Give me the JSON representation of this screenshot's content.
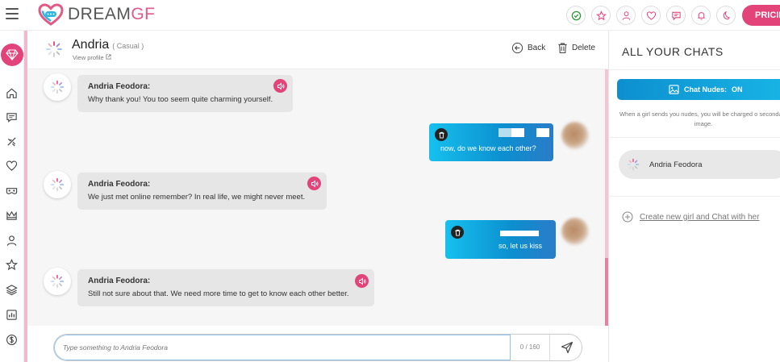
{
  "app": {
    "logo_brand": "DREAM",
    "logo_suffix": "GF",
    "pricing_label": "PRICING",
    "brand_color": "#e2447a"
  },
  "top_icons": [
    "badge-check-icon",
    "star-icon",
    "user-icon",
    "heart-icon",
    "chat-icon",
    "bell-icon",
    "moon-icon"
  ],
  "sidebar": {
    "items": [
      "home-icon",
      "chat-icon",
      "sliders-icon",
      "heart-icon",
      "mask-icon",
      "crown-icon",
      "user-icon",
      "star-icon",
      "layers-icon",
      "gallery-icon",
      "dollar-icon"
    ]
  },
  "chat_header": {
    "name": "Andria",
    "mood": "( Casual )",
    "view_profile": "View profile",
    "back_label": "Back",
    "delete_label": "Delete"
  },
  "messages": [
    {
      "from": "bot",
      "sender": "Andria Feodora:",
      "text": "Why thank you! You too seem quite charming yourself."
    },
    {
      "from": "user",
      "text": "now, do we know each other?"
    },
    {
      "from": "bot",
      "sender": "Andria Feodora:",
      "text": "We just met online remember? In real life, we might never meet."
    },
    {
      "from": "user",
      "text": "so, let us kiss"
    },
    {
      "from": "bot",
      "sender": "Andria Feodora:",
      "text": "Still not sure about that. We need more time to get to know each other better."
    }
  ],
  "input": {
    "placeholder": "Type something to Andria Feodora",
    "char_count": "0 / 160"
  },
  "right_panel": {
    "title": "ALL YOUR CHATS",
    "nudes_label": "Chat Nudes:",
    "nudes_state": "ON",
    "note": "When a girl sends you nudes, you will be charged o secondary image.",
    "chats": [
      {
        "name": "Andria Feodora"
      }
    ],
    "create_label": "Create new girl and Chat with her"
  }
}
